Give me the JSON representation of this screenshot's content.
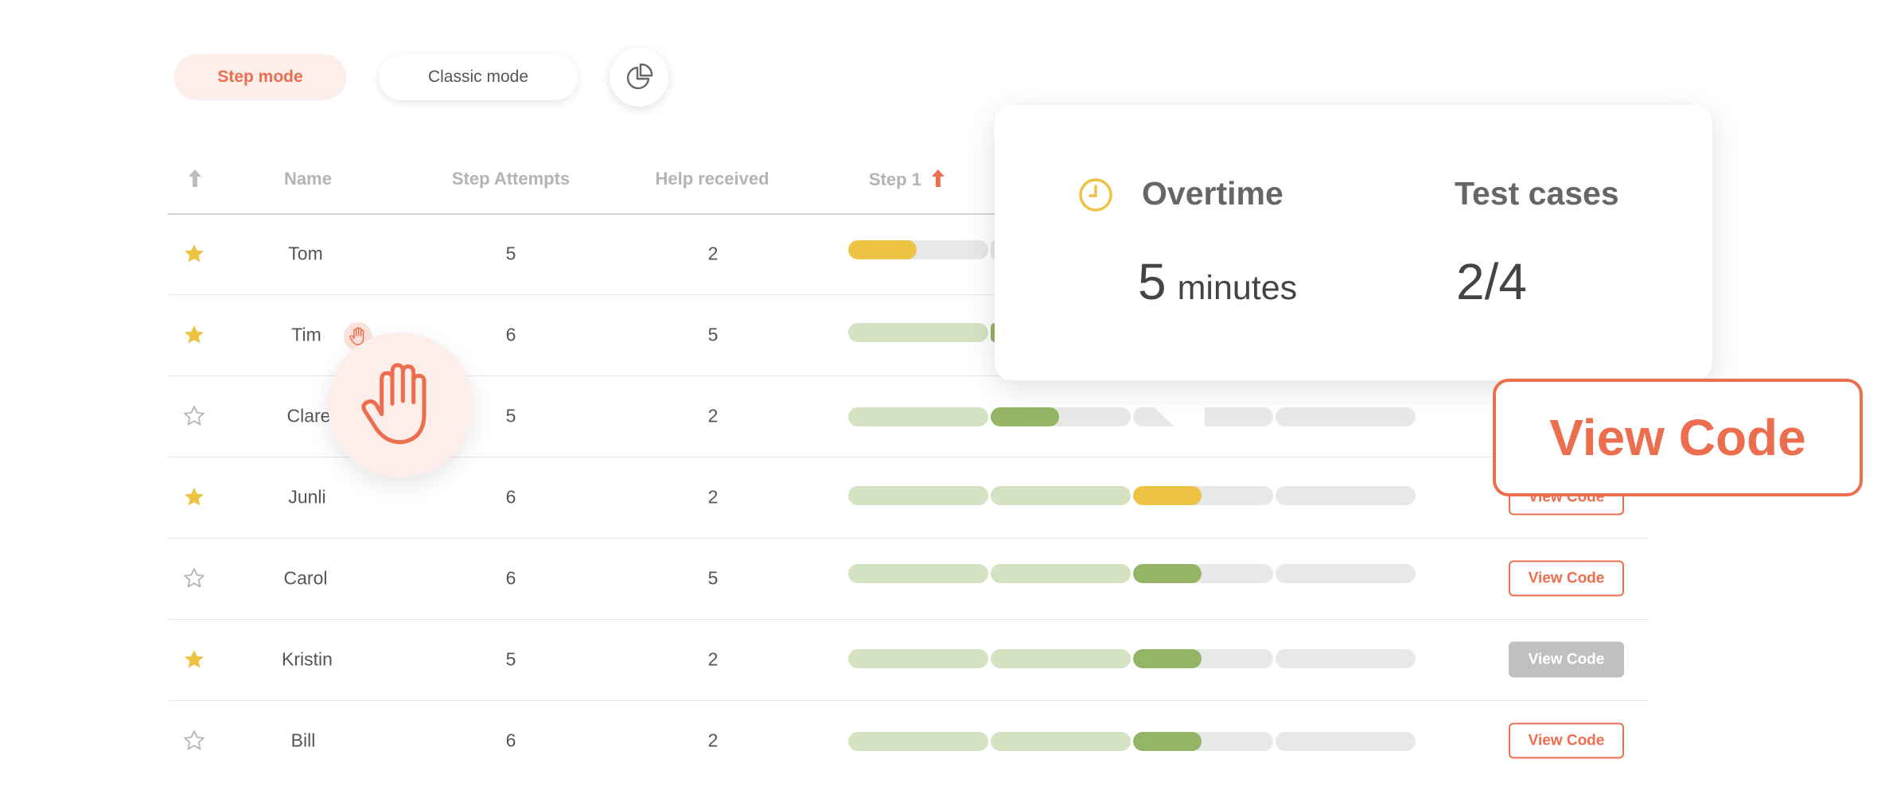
{
  "modes": {
    "step": "Step mode",
    "classic": "Classic mode"
  },
  "colors": {
    "accent": "#ec6e4f",
    "star": "#ecc343",
    "done": "#d5e3c3",
    "current_green": "#94b566",
    "current_yellow": "#ecc343",
    "empty": "#e8e8e8"
  },
  "table": {
    "headers": [
      "Name",
      "Step Attempts",
      "Help received",
      "Step 1"
    ],
    "rows": [
      {
        "name": "Tom",
        "attempts": "5",
        "help": "2",
        "starred": true
      },
      {
        "name": "Tim",
        "attempts": "6",
        "help": "5",
        "starred": true,
        "hand_raised": true
      },
      {
        "name": "Clare",
        "attempts": "5",
        "help": "2",
        "starred": false
      },
      {
        "name": "Junli",
        "attempts": "6",
        "help": "2",
        "starred": true,
        "view_code": "View Code"
      },
      {
        "name": "Carol",
        "attempts": "6",
        "help": "5",
        "starred": false,
        "view_code": "View Code"
      },
      {
        "name": "Kristin",
        "attempts": "5",
        "help": "2",
        "starred": true,
        "view_code": "View Code",
        "view_code_disabled": true
      },
      {
        "name": "Bill",
        "attempts": "6",
        "help": "2",
        "starred": false,
        "view_code": "View Code"
      }
    ]
  },
  "tooltip": {
    "overtime_title": "Overtime",
    "overtime_value": "5",
    "overtime_unit": "minutes",
    "tests_title": "Test cases",
    "tests_value": "2/4"
  },
  "callout": {
    "view_code": "View Code"
  }
}
